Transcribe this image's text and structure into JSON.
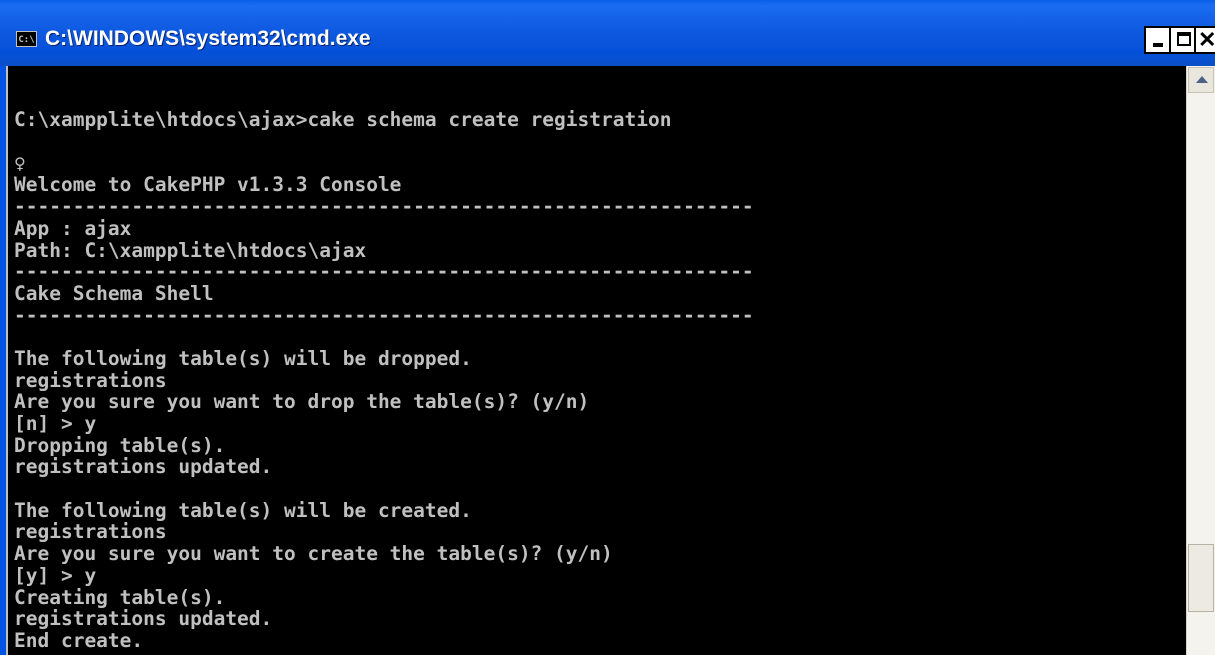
{
  "window": {
    "title": "C:\\WINDOWS\\system32\\cmd.exe",
    "icon_text": "C:\\",
    "buttons": {
      "minimize": "minimize-icon",
      "maximize": "maximize-icon",
      "close": "close-icon"
    }
  },
  "colors": {
    "titlebar": "#0054e3",
    "console_bg": "#000000",
    "console_fg": "#c0c0c0"
  },
  "console": {
    "lines": [
      "",
      "",
      "C:\\xampplite\\htdocs\\ajax>cake schema create registration",
      "",
      "♀",
      "Welcome to CakePHP v1.3.3 Console",
      "---------------------------------------------------------------",
      "App : ajax",
      "Path: C:\\xampplite\\htdocs\\ajax",
      "---------------------------------------------------------------",
      "Cake Schema Shell",
      "---------------------------------------------------------------",
      "",
      "The following table(s) will be dropped.",
      "registrations",
      "Are you sure you want to drop the table(s)? (y/n)",
      "[n] > y",
      "Dropping table(s).",
      "registrations updated.",
      "",
      "The following table(s) will be created.",
      "registrations",
      "Are you sure you want to create the table(s)? (y/n)",
      "[y] > y",
      "Creating table(s).",
      "registrations updated.",
      "End create."
    ]
  }
}
